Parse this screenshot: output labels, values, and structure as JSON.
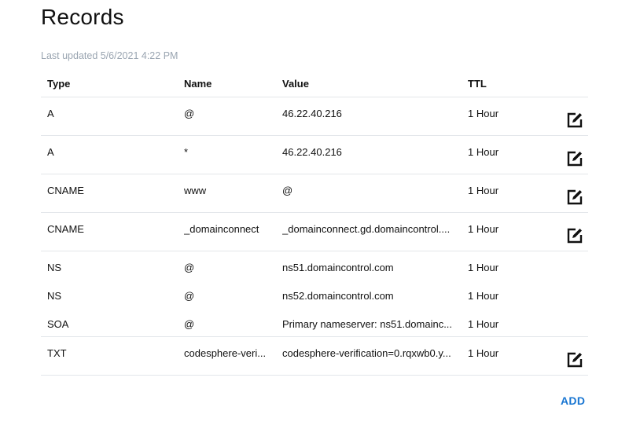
{
  "page": {
    "title": "Records",
    "last_updated": "Last updated 5/6/2021 4:22 PM"
  },
  "table": {
    "columns": [
      "Type",
      "Name",
      "Value",
      "TTL"
    ],
    "rows": [
      {
        "type": "A",
        "name": "@",
        "value": "46.22.40.216",
        "ttl": "1 Hour",
        "editable": true
      },
      {
        "type": "A",
        "name": "*",
        "value": "46.22.40.216",
        "ttl": "1 Hour",
        "editable": true
      },
      {
        "type": "CNAME",
        "name": "www",
        "value": "@",
        "ttl": "1 Hour",
        "editable": true
      },
      {
        "type": "CNAME",
        "name": "_domainconnect",
        "value": "_domainconnect.gd.domaincontrol....",
        "ttl": "1 Hour",
        "editable": true
      },
      {
        "type": "NS",
        "name": "@",
        "value": "ns51.domaincontrol.com",
        "ttl": "1 Hour",
        "editable": false
      },
      {
        "type": "NS",
        "name": "@",
        "value": "ns52.domaincontrol.com",
        "ttl": "1 Hour",
        "editable": false
      },
      {
        "type": "SOA",
        "name": "@",
        "value": "Primary nameserver: ns51.domainc...",
        "ttl": "1 Hour",
        "editable": false
      },
      {
        "type": "TXT",
        "name": "codesphere-veri...",
        "value": "codesphere-verification=0.rqxwb0.y...",
        "ttl": "1 Hour",
        "editable": true
      }
    ]
  },
  "actions": {
    "add_label": "ADD",
    "edit_icon": "edit-icon"
  },
  "colors": {
    "accent": "#1976d2",
    "muted_text": "#9aa5b1",
    "divider": "#e3e6ea",
    "text": "#111111"
  }
}
